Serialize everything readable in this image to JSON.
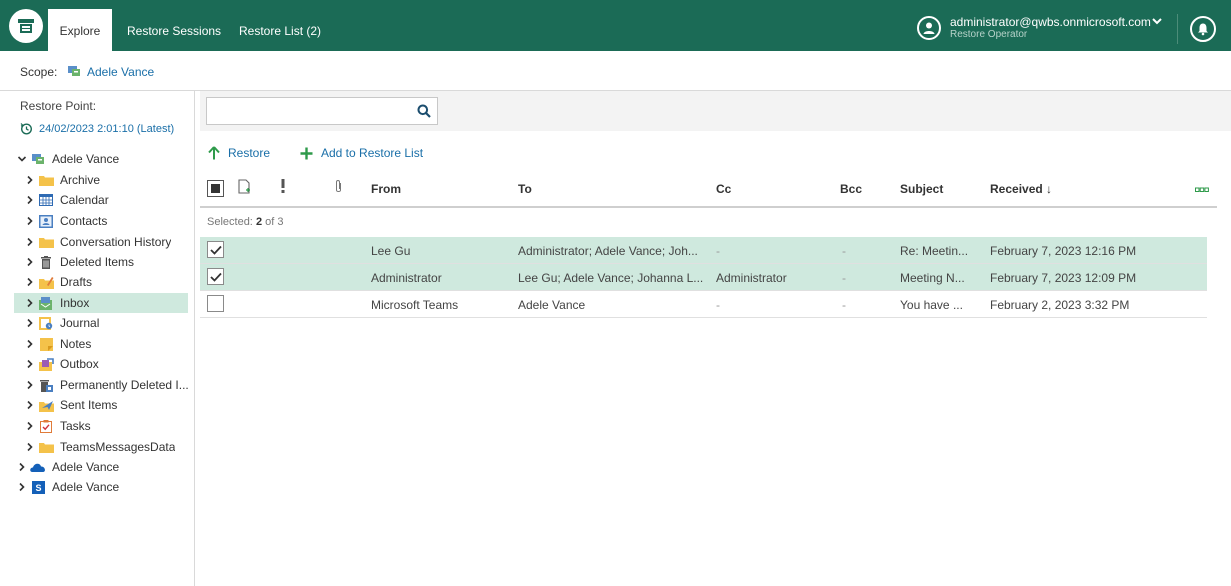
{
  "topbar": {
    "tabs": [
      {
        "label": "Explore",
        "active": true
      },
      {
        "label": "Restore Sessions",
        "active": false
      },
      {
        "label": "Restore List (2)",
        "active": false
      }
    ],
    "user": {
      "name": "administrator@qwbs.onmicrosoft.com",
      "role": "Restore Operator"
    },
    "icons": [
      "app-logo-icon",
      "user-avatar-icon",
      "chevron-down-icon",
      "bell-icon"
    ],
    "colors": {
      "brand": "#1b6b56",
      "link": "#1a6fa8",
      "selection": "#cfe9de"
    }
  },
  "scope": {
    "label": "Scope:",
    "value": "Adele Vance"
  },
  "restore_point": {
    "label": "Restore Point:",
    "value": "24/02/2023 2:01:10 (Latest)"
  },
  "tree": {
    "root": {
      "label": "Adele Vance",
      "expanded": true
    },
    "folders": [
      {
        "label": "Archive",
        "icon": "folder-icon"
      },
      {
        "label": "Calendar",
        "icon": "calendar-icon"
      },
      {
        "label": "Contacts",
        "icon": "contacts-icon"
      },
      {
        "label": "Conversation History",
        "icon": "folder-icon"
      },
      {
        "label": "Deleted Items",
        "icon": "trash-icon"
      },
      {
        "label": "Drafts",
        "icon": "drafts-icon"
      },
      {
        "label": "Inbox",
        "icon": "inbox-icon",
        "selected": true
      },
      {
        "label": "Journal",
        "icon": "journal-icon"
      },
      {
        "label": "Notes",
        "icon": "notes-icon"
      },
      {
        "label": "Outbox",
        "icon": "outbox-icon"
      },
      {
        "label": "Permanently Deleted I...",
        "icon": "permanently-deleted-icon"
      },
      {
        "label": "Sent Items",
        "icon": "sent-icon"
      },
      {
        "label": "Tasks",
        "icon": "tasks-icon"
      },
      {
        "label": "TeamsMessagesData",
        "icon": "folder-icon"
      }
    ],
    "others": [
      {
        "label": "Adele Vance",
        "icon": "onedrive-icon"
      },
      {
        "label": "Adele Vance",
        "icon": "sharepoint-icon"
      }
    ]
  },
  "search": {
    "placeholder": "",
    "value": ""
  },
  "actions": {
    "restore": "Restore",
    "add_to_list": "Add to Restore List"
  },
  "table": {
    "columns": {
      "from": "From",
      "to": "To",
      "cc": "Cc",
      "bcc": "Bcc",
      "subject": "Subject",
      "received": "Received ↓"
    },
    "selected_label": "Selected:",
    "selected_count": "2",
    "selected_of": "of 3",
    "rows": [
      {
        "checked": true,
        "from": "Lee Gu",
        "to": "Administrator; Adele Vance; Joh...",
        "cc": "-",
        "bcc": "-",
        "subject": "Re: Meetin...",
        "received": "February 7, 2023 12:16 PM"
      },
      {
        "checked": true,
        "from": "Administrator",
        "to": "Lee Gu; Adele Vance; Johanna L...",
        "cc": "Administrator",
        "bcc": "-",
        "subject": "Meeting N...",
        "received": "February 7, 2023 12:09 PM"
      },
      {
        "checked": false,
        "from": "Microsoft Teams",
        "to": "Adele Vance",
        "cc": "-",
        "bcc": "-",
        "subject": "You have ...",
        "received": "February 2, 2023 3:32 PM"
      }
    ]
  }
}
